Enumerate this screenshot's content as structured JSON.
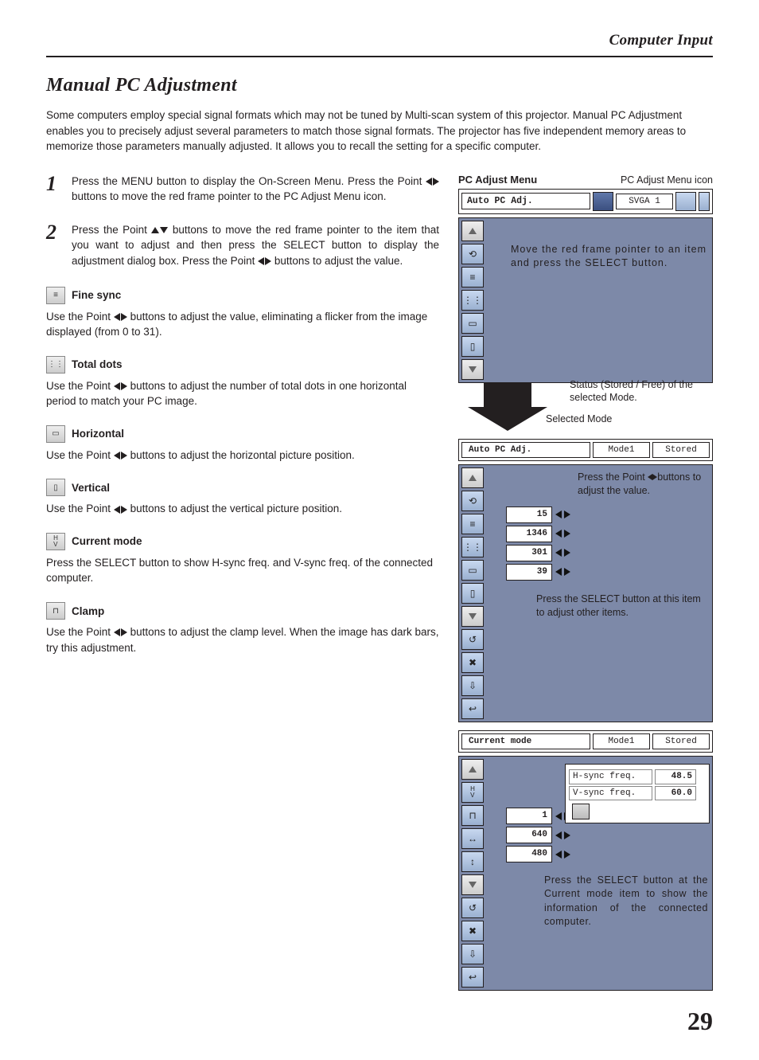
{
  "header": {
    "breadcrumb": "Computer Input"
  },
  "title": "Manual PC Adjustment",
  "intro": "Some computers employ special signal formats which may not be tuned by Multi-scan system of this projector. Manual PC Adjustment enables you to precisely adjust several parameters to match those signal formats.  The projector has five independent memory areas to memorize those parameters manually adjusted.  It allows you to recall the setting for a specific computer.",
  "steps": {
    "s1_num": "1",
    "s1_a": "Press the MENU button to display the On-Screen Menu.  Press the Point ",
    "s1_b": " buttons to move the red frame pointer to the PC Adjust Menu icon.",
    "s2_num": "2",
    "s2_a": "Press the Point ",
    "s2_b": " buttons to move the red frame pointer to the item that you want to adjust and then press the SELECT button to display the adjustment dialog box.  Press the Point ",
    "s2_c": " buttons to adjust the value."
  },
  "items": {
    "fine_sync_t": "Fine sync",
    "fine_sync_b1": "Use the Point ",
    "fine_sync_b2": " buttons to adjust the value, eliminating a flicker from the image displayed (from 0 to 31).",
    "total_dots_t": "Total dots",
    "total_dots_b1": "Use the Point ",
    "total_dots_b2": " buttons to adjust the number of total dots in one horizontal period to match your PC image.",
    "horizontal_t": "Horizontal",
    "horizontal_b1": "Use the Point ",
    "horizontal_b2": " buttons to adjust the horizontal picture position.",
    "vertical_t": "Vertical",
    "vertical_b1": "Use the Point ",
    "vertical_b2": " buttons to adjust the vertical picture position.",
    "current_t": "Current mode",
    "current_b": "Press the SELECT button to show H-sync freq. and V-sync freq. of the connected computer.",
    "clamp_t": "Clamp",
    "clamp_b1": "Use the Point ",
    "clamp_b2": " buttons to adjust the clamp level. When the image has dark bars, try this adjustment."
  },
  "right": {
    "icon_caption": "PC Adjust Menu icon",
    "menu_title": "PC Adjust Menu",
    "top_label": "Auto PC Adj.",
    "top_mode": "SVGA 1",
    "ann1": "Move the red frame pointer to an item and press the SELECT button.",
    "ann_sel": "Selected Mode",
    "ann_status": "Status (Stored / Free) of the selected Mode.",
    "bar2_main": "Auto PC Adj.",
    "bar2_mid": "Mode1",
    "bar2_end": "Stored",
    "ann2a": "Press the Point ",
    "ann2b": "buttons to adjust the value.",
    "vals": {
      "v1": "15",
      "v2": "1346",
      "v3": "301",
      "v4": "39"
    },
    "ann3": "Press the SELECT button at this item to adjust other items.",
    "bar3_main": "Current mode",
    "bar3_mid": "Mode1",
    "bar3_end": "Stored",
    "hsync_l": "H-sync freq.",
    "hsync_v": "48.5",
    "vsync_l": "V-sync freq.",
    "vsync_v": "60.0",
    "vals3": {
      "v1": "1",
      "v2": "640",
      "v3": "480"
    },
    "ann4": "Press the SELECT button at the Current mode item to show the information of the connected computer."
  },
  "page_num": "29"
}
